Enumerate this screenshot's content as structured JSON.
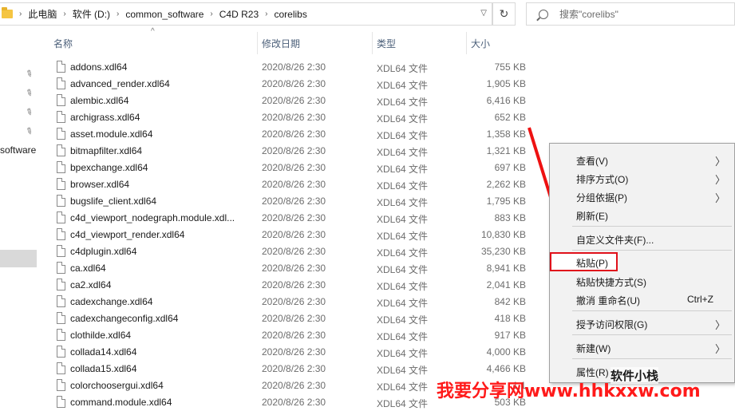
{
  "address": {
    "crumbs": [
      "此电脑",
      "软件 (D:)",
      "common_software",
      "C4D R23",
      "corelibs"
    ]
  },
  "search": {
    "placeholder": "搜索\"corelibs\""
  },
  "nav": {
    "partial_label": "software"
  },
  "columns": {
    "name": "名称",
    "date": "修改日期",
    "type": "类型",
    "size": "大小"
  },
  "files": [
    {
      "name": "addons.xdl64",
      "date": "2020/8/26 2:30",
      "type": "XDL64 文件",
      "size": "755 KB"
    },
    {
      "name": "advanced_render.xdl64",
      "date": "2020/8/26 2:30",
      "type": "XDL64 文件",
      "size": "1,905 KB"
    },
    {
      "name": "alembic.xdl64",
      "date": "2020/8/26 2:30",
      "type": "XDL64 文件",
      "size": "6,416 KB"
    },
    {
      "name": "archigrass.xdl64",
      "date": "2020/8/26 2:30",
      "type": "XDL64 文件",
      "size": "652 KB"
    },
    {
      "name": "asset.module.xdl64",
      "date": "2020/8/26 2:30",
      "type": "XDL64 文件",
      "size": "1,358 KB"
    },
    {
      "name": "bitmapfilter.xdl64",
      "date": "2020/8/26 2:30",
      "type": "XDL64 文件",
      "size": "1,321 KB"
    },
    {
      "name": "bpexchange.xdl64",
      "date": "2020/8/26 2:30",
      "type": "XDL64 文件",
      "size": "697 KB"
    },
    {
      "name": "browser.xdl64",
      "date": "2020/8/26 2:30",
      "type": "XDL64 文件",
      "size": "2,262 KB"
    },
    {
      "name": "bugslife_client.xdl64",
      "date": "2020/8/26 2:30",
      "type": "XDL64 文件",
      "size": "1,795 KB"
    },
    {
      "name": "c4d_viewport_nodegraph.module.xdl...",
      "date": "2020/8/26 2:30",
      "type": "XDL64 文件",
      "size": "883 KB"
    },
    {
      "name": "c4d_viewport_render.xdl64",
      "date": "2020/8/26 2:30",
      "type": "XDL64 文件",
      "size": "10,830 KB"
    },
    {
      "name": "c4dplugin.xdl64",
      "date": "2020/8/26 2:30",
      "type": "XDL64 文件",
      "size": "35,230 KB"
    },
    {
      "name": "ca.xdl64",
      "date": "2020/8/26 2:30",
      "type": "XDL64 文件",
      "size": "8,941 KB"
    },
    {
      "name": "ca2.xdl64",
      "date": "2020/8/26 2:30",
      "type": "XDL64 文件",
      "size": "2,041 KB"
    },
    {
      "name": "cadexchange.xdl64",
      "date": "2020/8/26 2:30",
      "type": "XDL64 文件",
      "size": "842 KB"
    },
    {
      "name": "cadexchangeconfig.xdl64",
      "date": "2020/8/26 2:30",
      "type": "XDL64 文件",
      "size": "418 KB"
    },
    {
      "name": "clothilde.xdl64",
      "date": "2020/8/26 2:30",
      "type": "XDL64 文件",
      "size": "917 KB"
    },
    {
      "name": "collada14.xdl64",
      "date": "2020/8/26 2:30",
      "type": "XDL64 文件",
      "size": "4,000 KB"
    },
    {
      "name": "collada15.xdl64",
      "date": "2020/8/26 2:30",
      "type": "XDL64 文件",
      "size": "4,466 KB"
    },
    {
      "name": "colorchoosergui.xdl64",
      "date": "2020/8/26 2:30",
      "type": "XDL64 文件",
      "size": "1,1"
    },
    {
      "name": "command.module.xdl64",
      "date": "2020/8/26 2:30",
      "type": "XDL64 文件",
      "size": "503 KB"
    }
  ],
  "menu": {
    "view": "查看(V)",
    "sort": "排序方式(O)",
    "group": "分组依据(P)",
    "refresh": "刷新(E)",
    "customize": "自定义文件夹(F)...",
    "paste": "粘贴(P)",
    "paste_shortcut": "粘贴快捷方式(S)",
    "undo": "撤消 重命名(U)",
    "undo_key": "Ctrl+Z",
    "grant_access": "授予访问权限(G)",
    "new": "新建(W)",
    "properties": "属性(R)"
  },
  "watermark": {
    "site": "我要分享网www.hhkxxw.com",
    "account": "软件小栈"
  },
  "colors": {
    "highlight": "#e0111b",
    "header_text": "#4c607a",
    "watermark": "#ff1a1a"
  }
}
